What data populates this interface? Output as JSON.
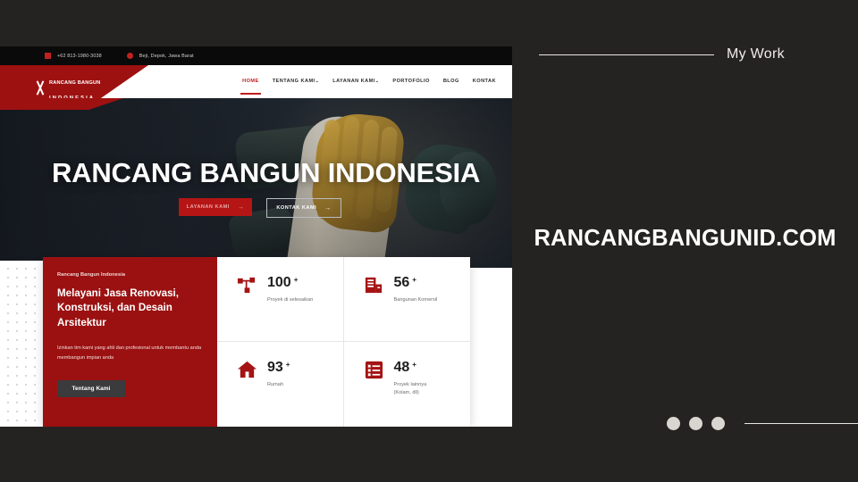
{
  "panel": {
    "eyebrow": "My Work",
    "site_title": "RANCANGBANGUNID.COM",
    "dots": [
      "dot-1",
      "dot-2",
      "dot-3"
    ],
    "accent_color": "#9e1111",
    "background_color": "#252322"
  },
  "site": {
    "topbar": {
      "phone": "+62 813-1980-3038",
      "location": "Beji, Depok, Jawa Barat",
      "phone_icon": "phone-icon",
      "location_icon": "globe-icon"
    },
    "logo": {
      "line1": "RANCANG BANGUN",
      "line2": "INDONESIA",
      "mark": "x-monogram-icon"
    },
    "nav": [
      {
        "label": "HOME",
        "active": true,
        "caret": ""
      },
      {
        "label": "TENTANG KAMI",
        "active": false,
        "caret": "⌄"
      },
      {
        "label": "LAYANAN KAMI",
        "active": false,
        "caret": "⌄"
      },
      {
        "label": "PORTOFOLIO",
        "active": false,
        "caret": ""
      },
      {
        "label": "BLOG",
        "active": false,
        "caret": ""
      },
      {
        "label": "KONTAK",
        "active": false,
        "caret": ""
      }
    ],
    "hero": {
      "title": "RANCANG BANGUN INDONESIA",
      "primary_button": "LAYANAN KAMI",
      "ghost_button": "KONTAK KAMI",
      "arrow": "→",
      "background_description": "gloved-hand-angle-grinder-photo"
    },
    "promo_card": {
      "kicker": "Rancang Bangun Indonesia",
      "heading": "Melayani Jasa Renovasi, Konstruksi, dan Desain Arsitektur",
      "description": "Izinkan tim kami yang ahli dan profesional untuk membantu anda membangun impian anda",
      "button": "Tentang Kami",
      "background_color": "#9b1111"
    },
    "stats": [
      {
        "icon": "network-nodes-icon",
        "value": "100",
        "plus": "+",
        "label": "Proyek di selesaikan"
      },
      {
        "icon": "office-building-icon",
        "value": "56",
        "plus": "+",
        "label": "Bangunan Komersil"
      },
      {
        "icon": "house-icon",
        "value": "93",
        "plus": "+",
        "label": "Rumah"
      },
      {
        "icon": "list-checklist-icon",
        "value": "48",
        "plus": "+",
        "label": "Proyek lainnya\n(Kolam, dll)"
      }
    ]
  }
}
